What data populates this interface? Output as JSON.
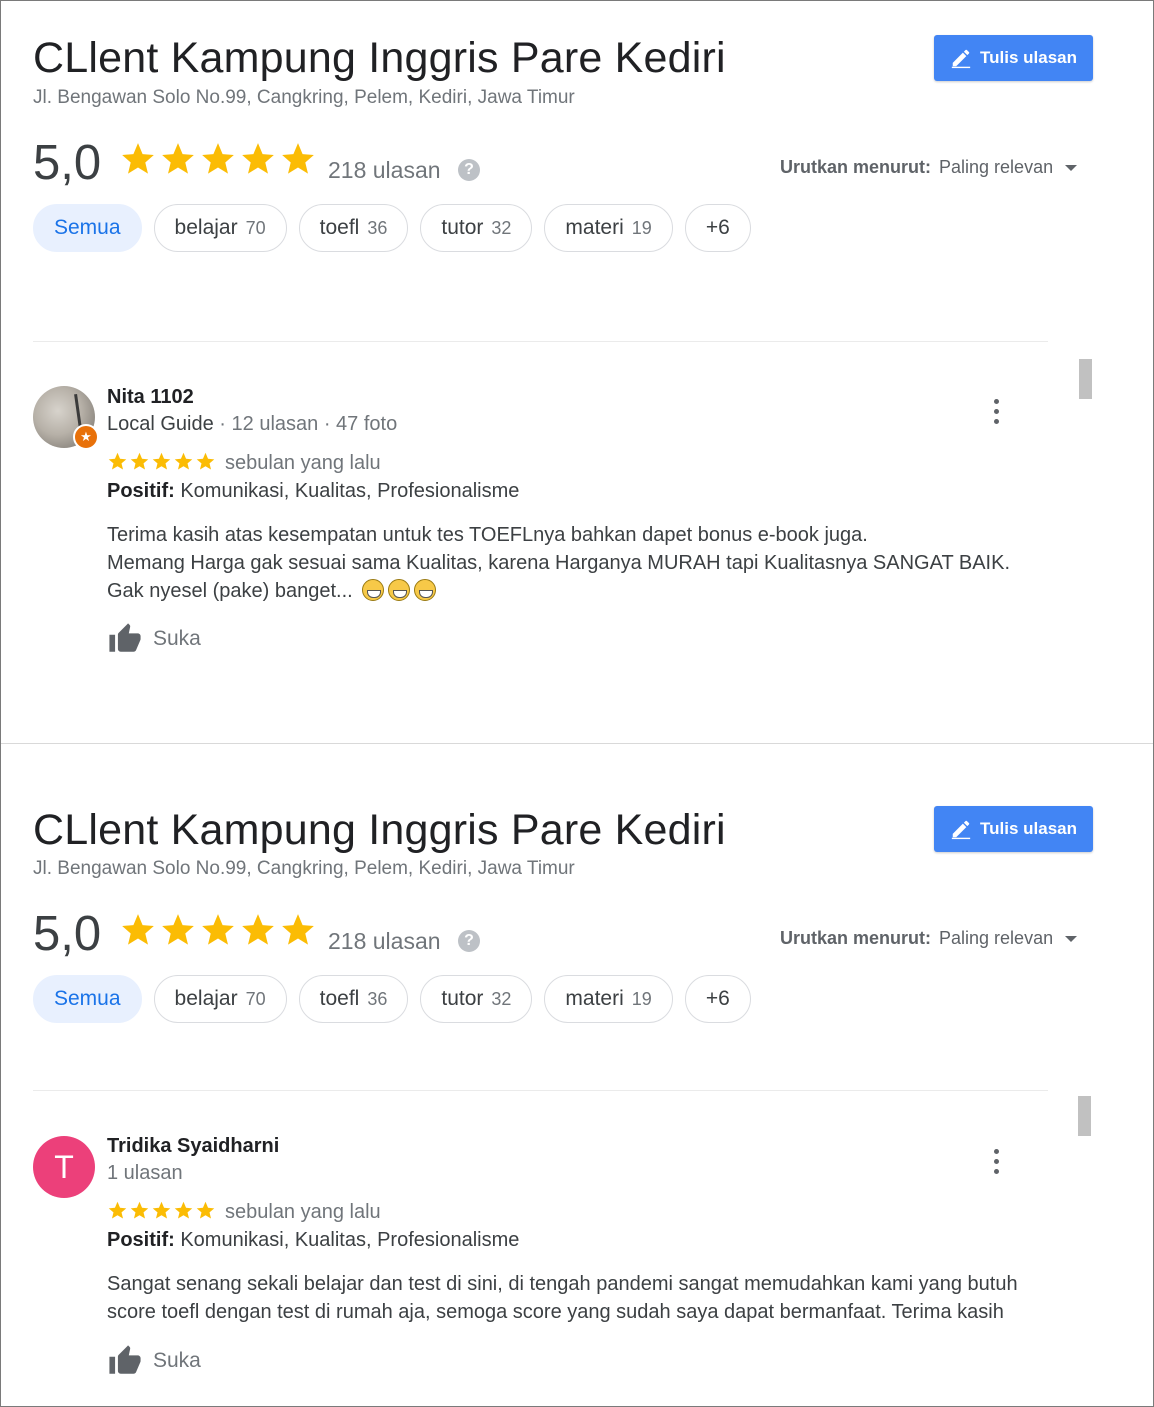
{
  "colors": {
    "accent": "#4285f4",
    "star": "#fbbc04",
    "chip_active_bg": "#e8f0fe",
    "chip_active_text": "#1a73e8"
  },
  "place": {
    "title": "CLlent Kampung Inggris Pare Kediri",
    "address": "Jl. Bengawan Solo No.99, Cangkring, Pelem, Kediri, Jawa Timur",
    "write_review_label": "Tulis ulasan",
    "rating": "5,0",
    "stars": 5,
    "review_count": "218 ulasan",
    "help_icon": "?",
    "sort_label": "Urutkan menurut:",
    "sort_value": "Paling relevan"
  },
  "chips": [
    {
      "label": "Semua",
      "count": ""
    },
    {
      "label": "belajar",
      "count": "70"
    },
    {
      "label": "toefl",
      "count": "36"
    },
    {
      "label": "tutor",
      "count": "32"
    },
    {
      "label": "materi",
      "count": "19"
    },
    {
      "label": "+6",
      "count": ""
    }
  ],
  "reviews": [
    {
      "name": "Nita 1102",
      "guide": "Local Guide",
      "meta": " · 12 ulasan · 47 foto",
      "stars": 5,
      "time": "sebulan yang lalu",
      "positif_label": "Positif:",
      "positif_value": " Komunikasi, Kualitas, Profesionalisme",
      "lines": [
        "Terima kasih atas kesempatan untuk tes TOEFLnya bahkan dapet bonus e-book juga.",
        "Memang Harga gak sesuai sama Kualitas, karena Harganya MURAH tapi Kualitasnya SANGAT BAIK.",
        "Gak nyesel (pake) banget..."
      ],
      "emoji_count": 3,
      "like_label": "Suka"
    },
    {
      "name": "Tridika Syaidharni",
      "avatar_letter": "T",
      "meta": "1 ulasan",
      "stars": 5,
      "time": "sebulan yang lalu",
      "positif_label": "Positif:",
      "positif_value": " Komunikasi, Kualitas, Profesionalisme",
      "lines": [
        "Sangat senang sekali belajar dan test di sini, di tengah pandemi sangat memudahkan kami yang butuh",
        "score toefl dengan test di rumah aja, semoga score yang sudah saya dapat bermanfaat. Terima kasih"
      ],
      "like_label": "Suka"
    }
  ]
}
